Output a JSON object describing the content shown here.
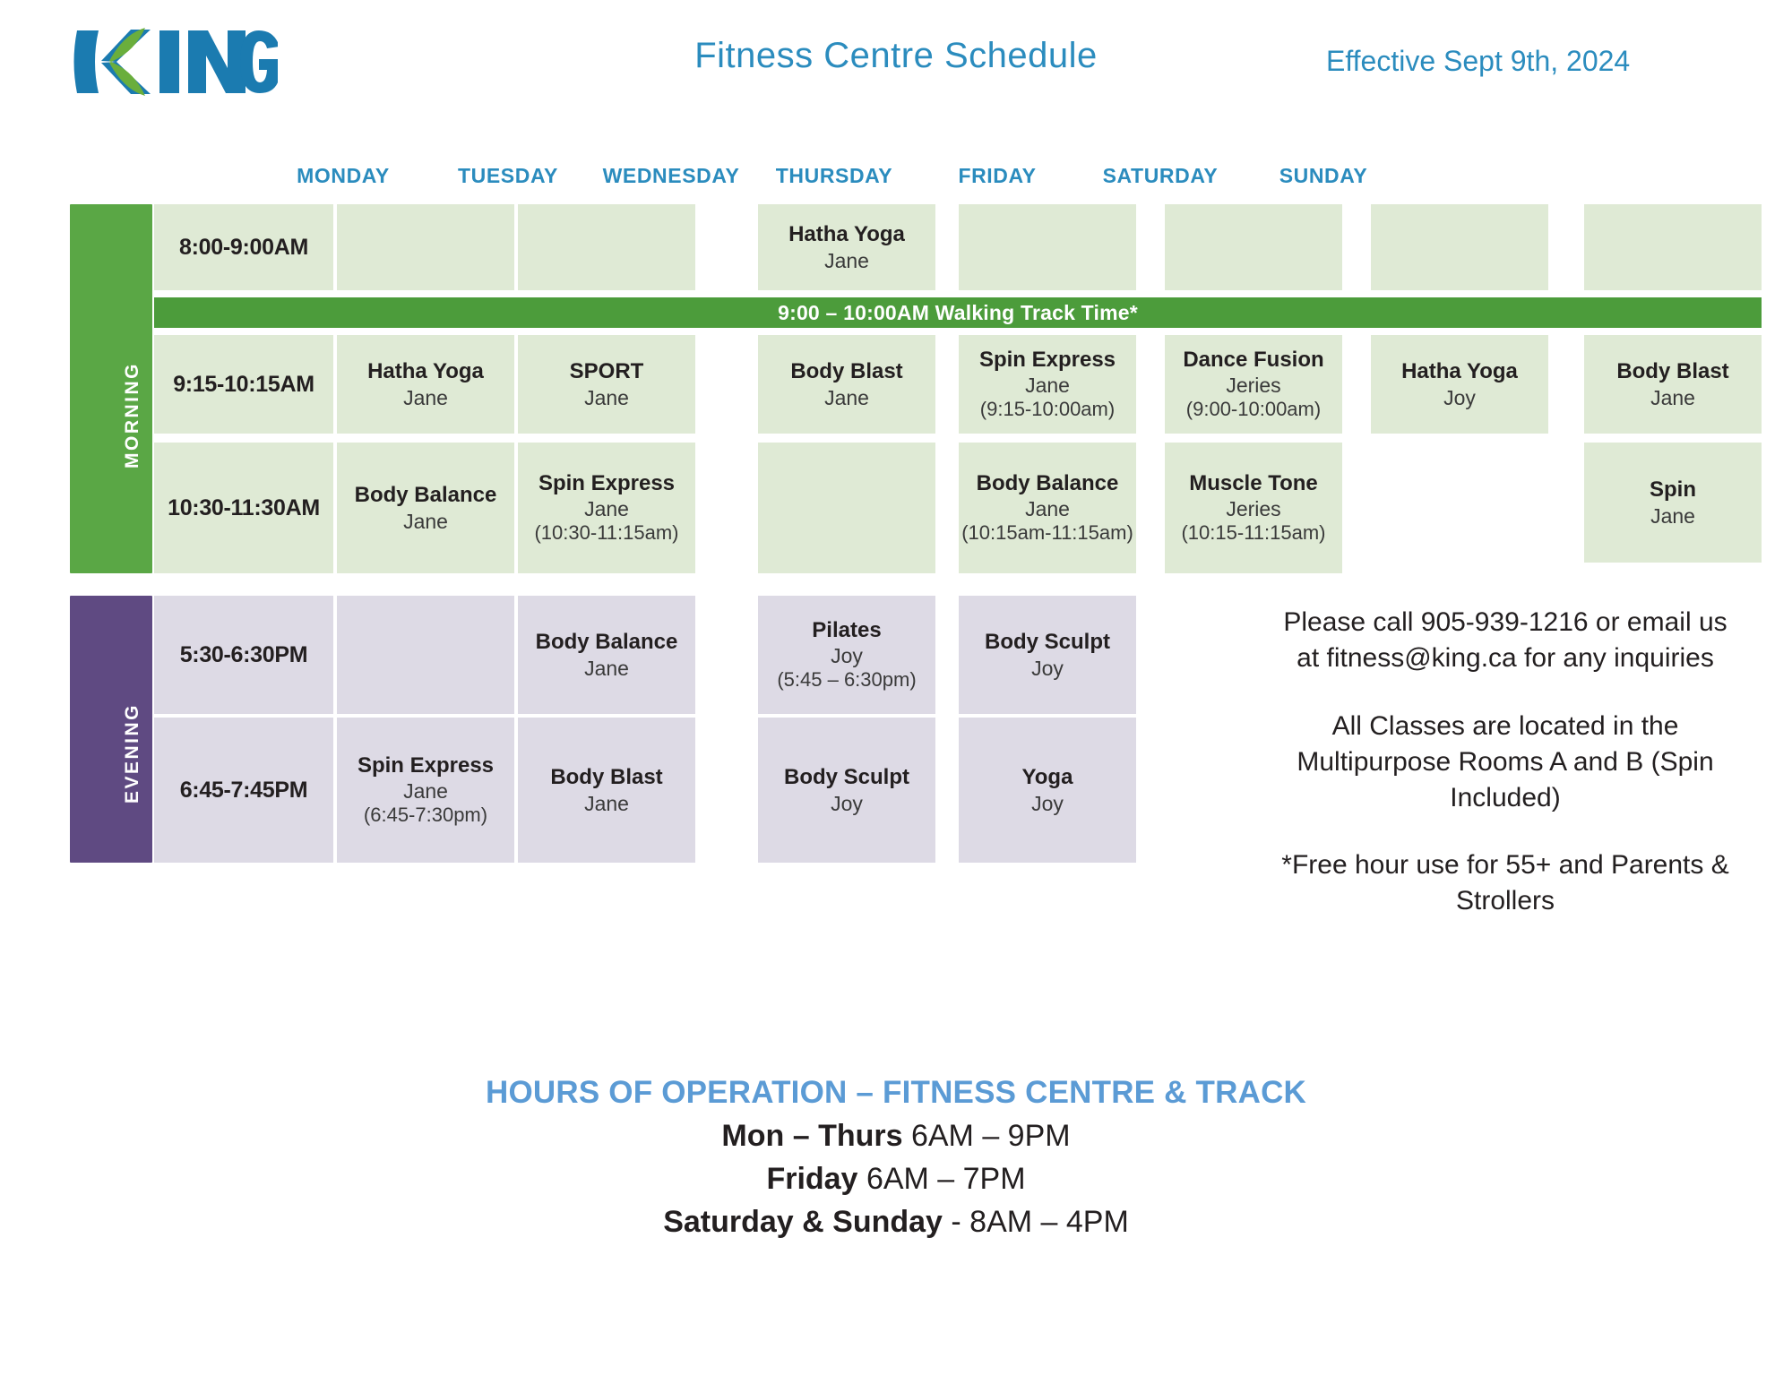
{
  "header": {
    "logo_text": "KING",
    "title": "Fitness Centre Schedule",
    "effective": "Effective Sept 9th, 2024"
  },
  "days": [
    "MONDAY",
    "TUESDAY",
    "WEDNESDAY",
    "THURSDAY",
    "FRIDAY",
    "SATURDAY",
    "SUNDAY"
  ],
  "sections": {
    "morning_label": "MORNING",
    "evening_label": "EVENING"
  },
  "track_band": "9:00 – 10:00AM Walking Track Time*",
  "times": {
    "r1": "8:00-9:00AM",
    "r2": "9:15-10:15AM",
    "r3": "10:30-11:30AM",
    "r4": "5:30-6:30PM",
    "r5": "6:45-7:45PM"
  },
  "schedule": {
    "r1": [
      {
        "name": "",
        "instructor": "",
        "time": ""
      },
      {
        "name": "",
        "instructor": "",
        "time": ""
      },
      {
        "name": "Hatha Yoga",
        "instructor": "Jane",
        "time": ""
      },
      {
        "name": "",
        "instructor": "",
        "time": ""
      },
      {
        "name": "",
        "instructor": "",
        "time": ""
      },
      {
        "name": "",
        "instructor": "",
        "time": ""
      },
      {
        "name": "",
        "instructor": "",
        "time": ""
      }
    ],
    "r2": [
      {
        "name": "Hatha Yoga",
        "instructor": "Jane",
        "time": ""
      },
      {
        "name": "SPORT",
        "instructor": "Jane",
        "time": ""
      },
      {
        "name": "Body Blast",
        "instructor": "Jane",
        "time": ""
      },
      {
        "name": "Spin Express",
        "instructor": "Jane",
        "time": "(9:15-10:00am)"
      },
      {
        "name": "Dance Fusion",
        "instructor": "Jeries",
        "time": "(9:00-10:00am)"
      },
      {
        "name": "Hatha Yoga",
        "instructor": "Joy",
        "time": ""
      },
      {
        "name": "Body Blast",
        "instructor": "Jane",
        "time": ""
      }
    ],
    "r3": [
      {
        "name": "Body Balance",
        "instructor": "Jane",
        "time": ""
      },
      {
        "name": "Spin Express",
        "instructor": "Jane",
        "time": "(10:30-11:15am)"
      },
      {
        "name": "",
        "instructor": "",
        "time": ""
      },
      {
        "name": "Body Balance",
        "instructor": "Jane",
        "time": "(10:15am-11:15am)"
      },
      {
        "name": "Muscle Tone",
        "instructor": "Jeries",
        "time": "(10:15-11:15am)"
      },
      {
        "name": "",
        "instructor": "",
        "time": ""
      },
      {
        "name": "Spin",
        "instructor": "Jane",
        "time": ""
      }
    ],
    "r4": [
      {
        "name": "",
        "instructor": "",
        "time": ""
      },
      {
        "name": "Body Balance",
        "instructor": "Jane",
        "time": ""
      },
      {
        "name": "Pilates",
        "instructor": "Joy",
        "time": "(5:45 – 6:30pm)"
      },
      {
        "name": "Body Sculpt",
        "instructor": "Joy",
        "time": ""
      }
    ],
    "r5": [
      {
        "name": "Spin Express",
        "instructor": "Jane",
        "time": "(6:45-7:30pm)"
      },
      {
        "name": "Body Blast",
        "instructor": "Jane",
        "time": ""
      },
      {
        "name": "Body Sculpt",
        "instructor": "Joy",
        "time": ""
      },
      {
        "name": "Yoga",
        "instructor": "Joy",
        "time": ""
      }
    ]
  },
  "info": {
    "line1": "Please call  905-939-1216 or email us",
    "line2": "at fitness@king.ca for any inquiries",
    "line3": "All Classes are located in the",
    "line4": "Multipurpose Rooms A and B (Spin",
    "line5": "Included)",
    "line6": "*Free hour use for 55+ and Parents &",
    "line7": "Strollers"
  },
  "hours": {
    "title": "HOURS OF OPERATION – FITNESS CENTRE & TRACK",
    "rows": [
      {
        "label": "Mon – Thurs",
        "value": "6AM – 9PM"
      },
      {
        "label": "Friday",
        "value": "6AM – 7PM"
      },
      {
        "label": "Saturday &  Sunday",
        "value": "- 8AM – 4PM"
      }
    ]
  },
  "colors": {
    "brand_blue": "#2b8cbe",
    "morning_rail": "#5aa745",
    "morning_cell": "#dfead5",
    "evening_rail": "#5f4a82",
    "evening_cell": "#dddae5",
    "track_band": "#4c9c3b",
    "hours_title": "#5b9bd5"
  }
}
